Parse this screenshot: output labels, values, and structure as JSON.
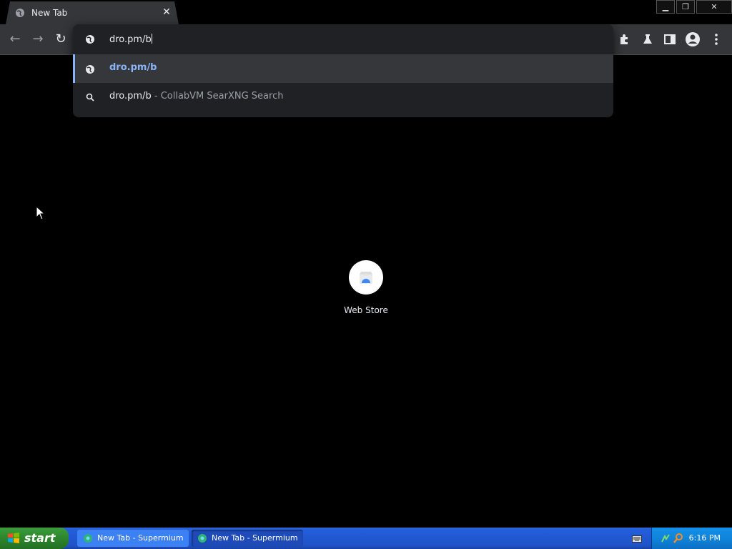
{
  "browser": {
    "tab": {
      "title": "New Tab",
      "close_label": "✕"
    },
    "window_buttons": {
      "minimize": "▁",
      "restore": "❐",
      "close": "✕"
    },
    "nav": {
      "back": "←",
      "forward": "→",
      "reload": "↻"
    },
    "toolbar_icons": [
      "extensions-icon",
      "labs-icon",
      "side-panel-icon",
      "profile-icon",
      "menu-icon"
    ]
  },
  "omnibox": {
    "input_value": "dro.pm/b",
    "suggestions": [
      {
        "type": "url",
        "url": "dro.pm/b",
        "selected": true
      },
      {
        "type": "search",
        "query": "dro.pm/b",
        "separator": " - ",
        "engine": "CollabVM SearXNG Search",
        "selected": false
      }
    ]
  },
  "new_tab": {
    "shortcuts": [
      {
        "label": "Web Store",
        "icon": "web-store-icon"
      }
    ]
  },
  "taskbar": {
    "start_label": "start",
    "windows": [
      {
        "label": "New Tab - Supermium",
        "active": false
      },
      {
        "label": "New Tab - Supermium",
        "active": true
      }
    ],
    "clock": "6:16 PM"
  },
  "colors": {
    "accent": "#8ab4f8",
    "toolbar": "#35363a",
    "omnibox": "#202124",
    "taskbar": "#245edb",
    "start": "#2f8a2f"
  }
}
